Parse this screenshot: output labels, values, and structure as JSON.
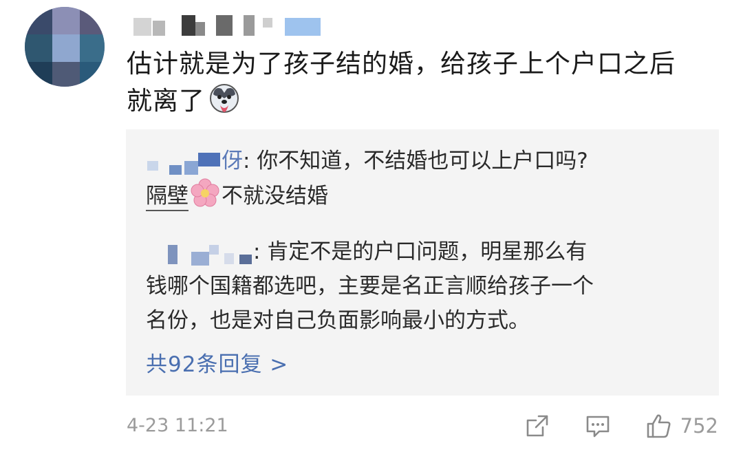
{
  "comment": {
    "text_line1": "估计就是为了孩子结的婚，给孩子上个户口之后",
    "text_line2": "就离了",
    "emoji_icon": "husky-emoji-icon"
  },
  "replies": [
    {
      "name_visible_suffix": "伢",
      "text_part1": ": 你不知道，不结婚也可以上户口吗?",
      "link_text": "隔壁",
      "flower_icon": "sakura-emoji-icon",
      "text_part2": "不就没结婚"
    },
    {
      "text_line1": ": 肯定不是的户口问题，明星那么有",
      "text_line2": "钱哪个国籍都选吧，主要是名正言顺给孩子一个",
      "text_line3": "名份，也是对自己负面影响最小的方式。"
    }
  ],
  "more_replies_label": "共92条回复 >",
  "footer": {
    "timestamp": "4-23 11:21",
    "like_count": "752"
  },
  "colors": {
    "link_blue": "#4a6fb0",
    "reply_bg": "#f4f4f4",
    "meta_gray": "#9b9b9b"
  }
}
